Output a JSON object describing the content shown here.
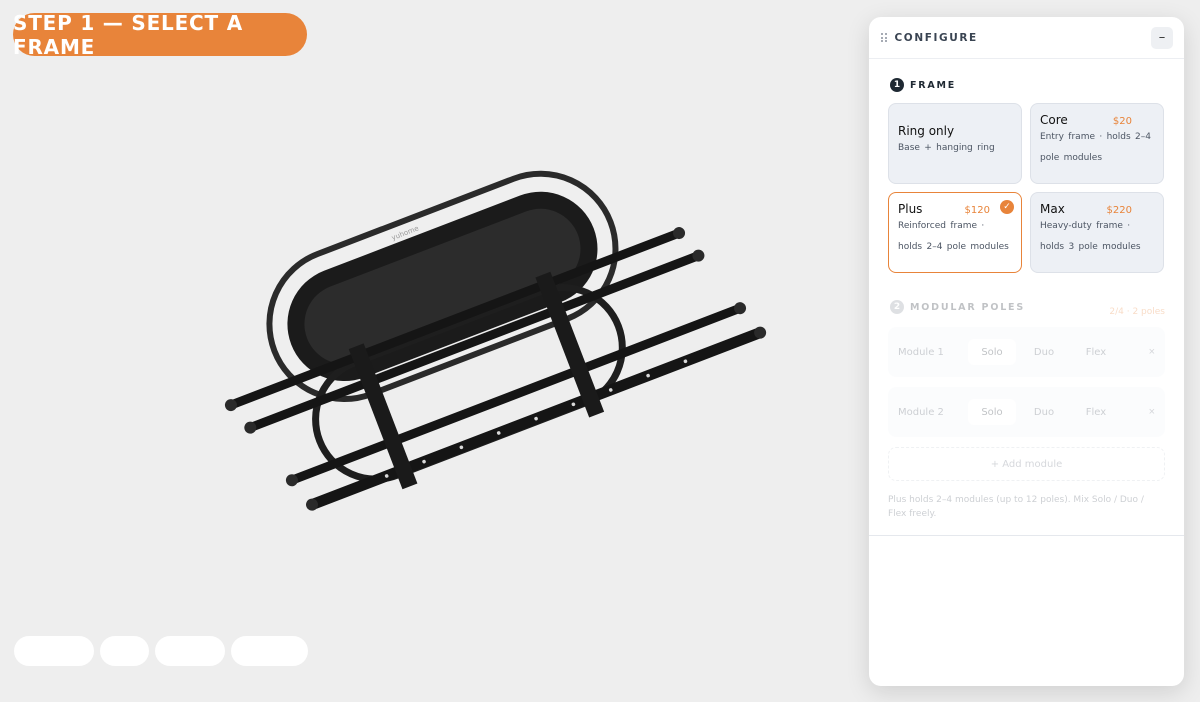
{
  "step_label": "STEP 1 — SELECT A FRAME",
  "viewer": {
    "product_brand_text": "yuhome"
  },
  "configure": {
    "title": "CONFIGURE",
    "minimize_label": "–",
    "frame_section": {
      "number": "1",
      "label": "FRAME",
      "options": [
        {
          "name": "Ring only",
          "price": "",
          "desc": "Base + hanging ring",
          "selected": false
        },
        {
          "name": "Core",
          "price": "$20",
          "desc": "Entry frame · holds 2–4 pole modules",
          "selected": false
        },
        {
          "name": "Plus",
          "price": "$120",
          "desc": "Reinforced frame · holds 2–4 pole modules",
          "selected": true
        },
        {
          "name": "Max",
          "price": "$220",
          "desc": "Heavy-duty frame · holds 3 pole modules",
          "selected": false
        }
      ]
    },
    "poles_section": {
      "number": "2",
      "label": "MODULAR POLES",
      "count": "2/4 · 2 poles",
      "modules": [
        {
          "label": "Module 1",
          "options": [
            "Solo",
            "Duo",
            "Flex"
          ],
          "selected": "Solo",
          "remove": "×"
        },
        {
          "label": "Module 2",
          "options": [
            "Solo",
            "Duo",
            "Flex"
          ],
          "selected": "Solo",
          "remove": "×"
        }
      ],
      "add_label": "+ Add module",
      "note": "Plus holds 2–4 modules (up to 12 poles). Mix Solo / Duo / Flex freely."
    }
  },
  "colors": {
    "accent": "#e8843a",
    "background": "#eeeeee",
    "panel": "#ffffff",
    "card": "#edf0f5"
  }
}
